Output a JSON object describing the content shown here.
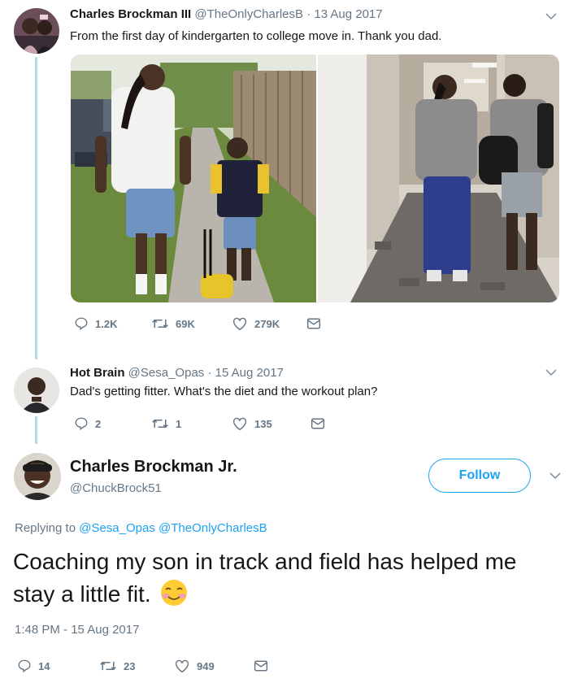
{
  "tweet1": {
    "name": "Charles Brockman III",
    "handle": "@TheOnlyCharlesB",
    "date": "· 13 Aug 2017",
    "text": "From the first day of kindergarten to college move in. Thank you dad.",
    "replies": "1.2K",
    "retweets": "69K",
    "likes": "279K"
  },
  "tweet2": {
    "name": "Hot Brain",
    "handle": "@Sesa_Opas",
    "date": "· 15 Aug 2017",
    "text": "Dad's getting fitter. What's the diet and the workout plan?",
    "replies": "2",
    "retweets": "1",
    "likes": "135"
  },
  "main_tweet": {
    "name": "Charles Brockman Jr.",
    "handle": "@ChuckBrock51",
    "follow_label": "Follow",
    "replying_prefix": "Replying to",
    "replying_to_1": "@Sesa_Opas",
    "replying_to_2": "@TheOnlyCharlesB",
    "text": "Coaching my son in track and field has helped me stay a little fit.",
    "emoji": "smiling-face-with-blush",
    "timestamp": "1:48 PM - 15 Aug 2017",
    "replies": "14",
    "retweets": "23",
    "likes": "949"
  },
  "colors": {
    "accent": "#1da1f2",
    "secondary_text": "#657786",
    "thread_line": "#b4dde9"
  }
}
